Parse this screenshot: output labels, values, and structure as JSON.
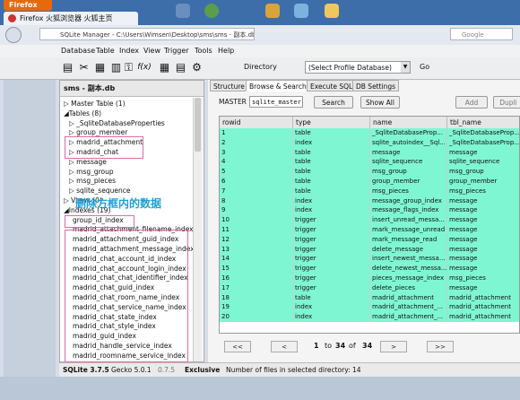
{
  "browser": {
    "menu_button": "Firefox",
    "tab_title": "Firefox 火狐浏览器 火狐主页",
    "url": "SQLite Manager - C:\\Users\\Wimsen\\Desktop\\sms\\sms - 副本.db",
    "search_placeholder": "Google"
  },
  "menu": [
    "Database",
    "Table",
    "Index",
    "View",
    "Trigger",
    "Tools",
    "Help"
  ],
  "toolbar": {
    "directory_label": "Directory",
    "profile_select": "(Select Profile Database)",
    "go_label": "Go"
  },
  "left_panel": {
    "db_name": "sms - 副本.db",
    "tree": [
      "▷ Master Table (1)",
      "◢Tables (8)",
      "▷ _SqliteDatabaseProperties",
      "▷ group_member",
      "▷ madrid_attachment",
      "▷ madrid_chat",
      "▷ message",
      "▷ msg_group",
      "▷ msg_pieces",
      "▷ sqlite_sequence",
      "▷ Views (0)",
      "◢Indexes (19)",
      "group_id_index",
      "madrid_attachment_filename_index",
      "madrid_attachment_guid_index",
      "madrid_attachment_message_index",
      "madrid_chat_account_id_index",
      "madrid_chat_account_login_index",
      "madrid_chat_chat_identifier_index",
      "madrid_chat_guid_index",
      "madrid_chat_room_name_index",
      "madrid_chat_service_name_index",
      "madrid_chat_state_index",
      "madrid_chat_style_index",
      "madrid_guid_index",
      "madrid_handle_service_index",
      "madrid_roomname_service_index"
    ],
    "annotation": "删除方框内的数据"
  },
  "tabs": [
    "Structure",
    "Browse & Search",
    "Execute SQL",
    "DB Settings"
  ],
  "active_tab": 1,
  "filter": {
    "label": "MASTER",
    "table_value": "sqlite_master",
    "search_label": "Search",
    "show_all_label": "Show All",
    "add_label": "Add",
    "dup_label": "Dupli"
  },
  "grid": {
    "columns": [
      "rowid",
      "type",
      "name",
      "tbl_name"
    ],
    "rows": [
      [
        "1",
        "table",
        "_SqliteDatabaseProp...",
        "_SqliteDatabaseProp..."
      ],
      [
        "2",
        "index",
        "sqlite_autoindex__Sql...",
        "_SqliteDatabaseProp..."
      ],
      [
        "3",
        "table",
        "message",
        "message"
      ],
      [
        "4",
        "table",
        "sqlite_sequence",
        "sqlite_sequence"
      ],
      [
        "5",
        "table",
        "msg_group",
        "msg_group"
      ],
      [
        "6",
        "table",
        "group_member",
        "group_member"
      ],
      [
        "7",
        "table",
        "msg_pieces",
        "msg_pieces"
      ],
      [
        "8",
        "index",
        "message_group_index",
        "message"
      ],
      [
        "9",
        "index",
        "message_flags_index",
        "message"
      ],
      [
        "10",
        "trigger",
        "insert_unread_messa...",
        "message"
      ],
      [
        "11",
        "trigger",
        "mark_message_unread",
        "message"
      ],
      [
        "12",
        "trigger",
        "mark_message_read",
        "message"
      ],
      [
        "13",
        "trigger",
        "delete_message",
        "message"
      ],
      [
        "14",
        "trigger",
        "insert_newest_messa...",
        "message"
      ],
      [
        "15",
        "trigger",
        "delete_newest_messa...",
        "message"
      ],
      [
        "16",
        "trigger",
        "pieces_message_index",
        "msg_pieces"
      ],
      [
        "17",
        "trigger",
        "delete_pieces",
        "message"
      ],
      [
        "18",
        "table",
        "madrid_attachment",
        "madrid_attachment"
      ],
      [
        "19",
        "index",
        "madrid_attachment_...",
        "madrid_attachment"
      ],
      [
        "20",
        "index",
        "madrid_attachment_...",
        "madrid_attachment"
      ]
    ]
  },
  "pager": {
    "first": "<<",
    "prev": "<",
    "page": "1",
    "to_word": "to",
    "to": "34",
    "of_word": "of",
    "total": "34",
    "next": ">",
    "last": ">>"
  },
  "status": {
    "sqlite": "SQLite 3.7.5",
    "gecko": "Gecko 5.0.1",
    "version": "0.7.5",
    "mode": "Exclusive",
    "files": "Number of files in selected directory: 14"
  },
  "colors": {
    "row_highlight": "#7ff6d2",
    "annotation_box": "#e06aa7",
    "annotation_text": "#1e9fd6",
    "firefox_orange": "#e6690d"
  },
  "icons": [
    "new-db-icon",
    "tools-icon",
    "export-icon",
    "table-icon",
    "key-icon",
    "function-icon",
    "settings-icon"
  ]
}
